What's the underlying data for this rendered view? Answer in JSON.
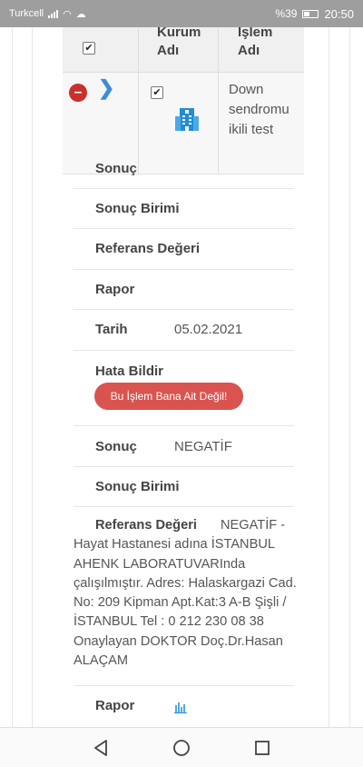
{
  "status_bar": {
    "carrier": "Turkcell",
    "battery_percent": "%39",
    "time": "20:50"
  },
  "table": {
    "headers": {
      "kurum_adi": "Kurum Adı",
      "islem_adi": "İşlem Adı"
    },
    "row": {
      "islem": "Down sendromu ikili test"
    }
  },
  "details_1": {
    "sonuc_label": "Sonuç",
    "sonuc_birimi_label": "Sonuç Birimi",
    "referans_label": "Referans Değeri",
    "rapor_label": "Rapor",
    "tarih_label": "Tarih",
    "tarih_value": "05.02.2021",
    "hata_label": "Hata Bildir",
    "hata_button": "Bu İşlem Bana Ait Değil!"
  },
  "details_2": {
    "sonuc_label": "Sonuç",
    "sonuc_value": "NEGATİF",
    "sonuc_birimi_label": "Sonuç Birimi",
    "referans_label": "Referans Değeri",
    "referans_value": "NEGATİF - Hayat Hastanesi adına İSTANBUL AHENK LABORATUVARInda çalışılmıştır. Adres: Halaskargazi Cad. No: 209 Kipman Apt.Kat:3 A-B Şişli / İSTANBUL Tel : 0 212 230 08 38 Onaylayan DOKTOR Doç.Dr.Hasan ALAÇAM",
    "rapor_label": "Rapor"
  },
  "icons": {
    "remove": "minus-circle-icon",
    "expand": "chevron-right-icon",
    "institution": "building-icon",
    "report": "bar-chart-icon"
  },
  "colors": {
    "danger": "#d9534f",
    "accent": "#3a8fd6",
    "icon_blue": "#1f8ed6"
  }
}
